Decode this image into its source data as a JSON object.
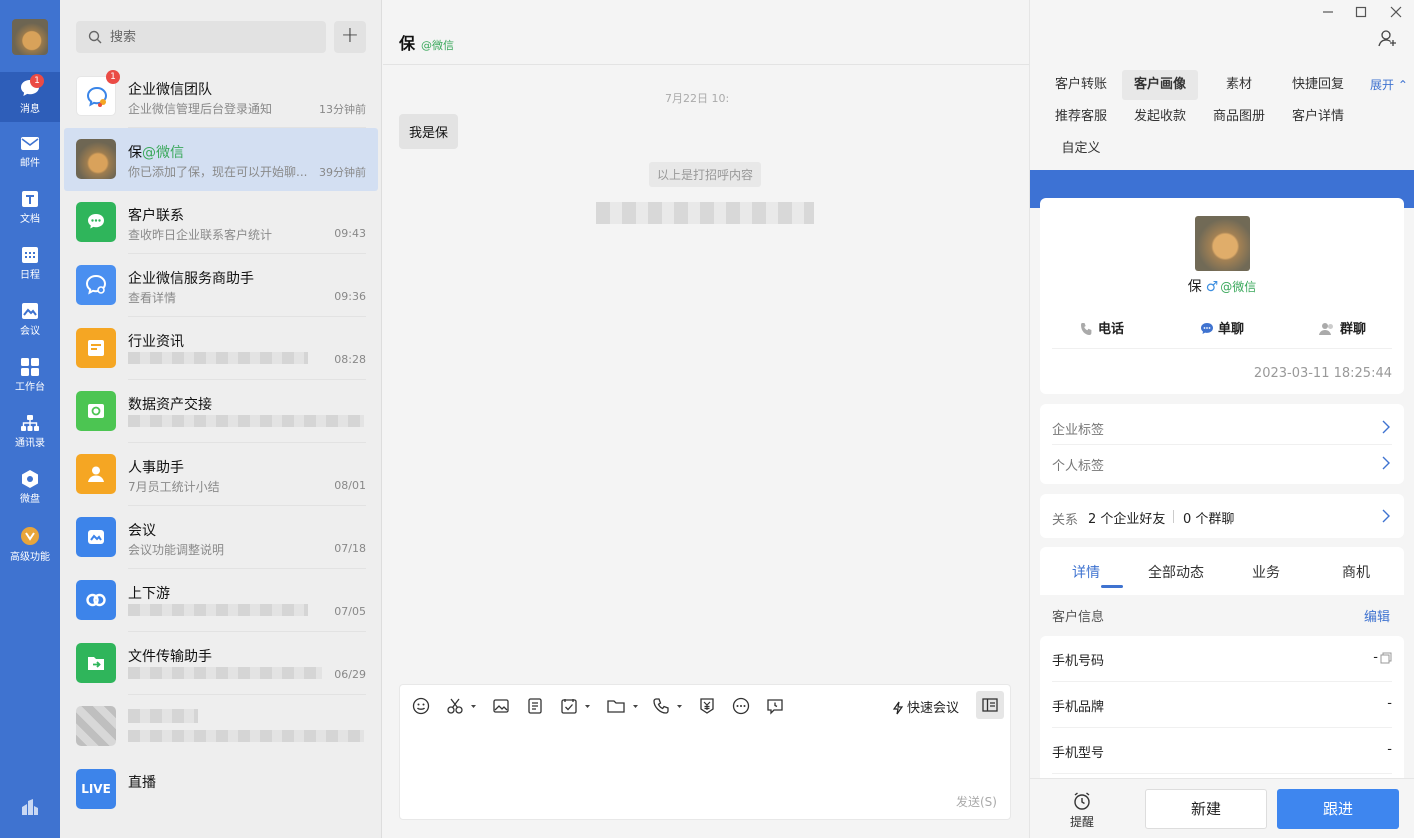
{
  "nav": {
    "items": [
      {
        "label": "消息",
        "icon": "message-icon",
        "badge": "1"
      },
      {
        "label": "邮件",
        "icon": "mail-icon"
      },
      {
        "label": "文档",
        "icon": "document-icon"
      },
      {
        "label": "日程",
        "icon": "calendar-icon"
      },
      {
        "label": "会议",
        "icon": "meeting-icon"
      },
      {
        "label": "工作台",
        "icon": "workbench-icon"
      },
      {
        "label": "通讯录",
        "icon": "contacts-icon"
      },
      {
        "label": "微盘",
        "icon": "drive-icon"
      },
      {
        "label": "高级功能",
        "icon": "premium-icon"
      }
    ]
  },
  "search": {
    "placeholder": "搜索"
  },
  "conversations": [
    {
      "name": "企业微信团队",
      "preview": "企业微信管理后台登录通知",
      "time": "13分钟前",
      "badge": "1",
      "color": "#ffffff"
    },
    {
      "name": "保",
      "suffix": "@微信",
      "preview": "你已添加了保，现在可以开始聊...",
      "time": "39分钟前",
      "color": "#8a7a60"
    },
    {
      "name": "客户联系",
      "preview": "查收昨日企业联系客户统计",
      "time": "09:43",
      "color": "#2fb55b"
    },
    {
      "name": "企业微信服务商助手",
      "preview": "查看详情",
      "time": "09:36",
      "color": "#4a8ff0"
    },
    {
      "name": "行业资讯",
      "preview": "",
      "time": "08:28",
      "color": "#f5a623"
    },
    {
      "name": "数据资产交接",
      "preview": "",
      "time": "",
      "color": "#4cc552"
    },
    {
      "name": "人事助手",
      "preview": "7月员工统计小结",
      "time": "08/01",
      "color": "#f5a623"
    },
    {
      "name": "会议",
      "preview": "会议功能调整说明",
      "time": "07/18",
      "color": "#3d84ea"
    },
    {
      "name": "上下游",
      "preview": "",
      "time": "07/05",
      "color": "#3d84ea"
    },
    {
      "name": "文件传输助手",
      "preview": "",
      "time": "06/29",
      "color": "#2fb55b"
    },
    {
      "name": "",
      "preview": "",
      "time": "",
      "color": "#c9c9c9"
    },
    {
      "name": "直播",
      "preview": "",
      "time": "",
      "color": "#3d84ea",
      "icon_text": "LIVE"
    }
  ],
  "chat": {
    "title": "保",
    "title_suffix": "@微信",
    "timestamp": "7月22日 10:",
    "bubble": "我是保",
    "system_note": "以上是打招呼内容",
    "toolbar_quick": "快速会议",
    "send": "发送(S)"
  },
  "right": {
    "tabs": [
      "客户转账",
      "客户画像",
      "素材",
      "快捷回复",
      "推荐客服",
      "发起收款",
      "商品图册",
      "客户详情",
      "自定义"
    ],
    "expand": "展开",
    "profile": {
      "name": "保",
      "gender": "♂",
      "suffix": "@微信",
      "actions": [
        "电话",
        "单聊",
        "群聊"
      ],
      "date": "2023-03-11 18:25:44"
    },
    "tags": [
      "企业标签",
      "个人标签"
    ],
    "relation": {
      "label": "关系",
      "friends": "2 个企业好友",
      "groups": "0 个群聊"
    },
    "subtabs": [
      "详情",
      "全部动态",
      "业务",
      "商机"
    ],
    "info_title": "客户信息",
    "edit": "编辑",
    "info_rows": [
      {
        "key": "手机号码",
        "value": "-"
      },
      {
        "key": "手机品牌",
        "value": "-"
      },
      {
        "key": "手机型号",
        "value": "-"
      }
    ],
    "footer": {
      "reminder": "提醒",
      "new": "新建",
      "follow": "跟进"
    }
  }
}
